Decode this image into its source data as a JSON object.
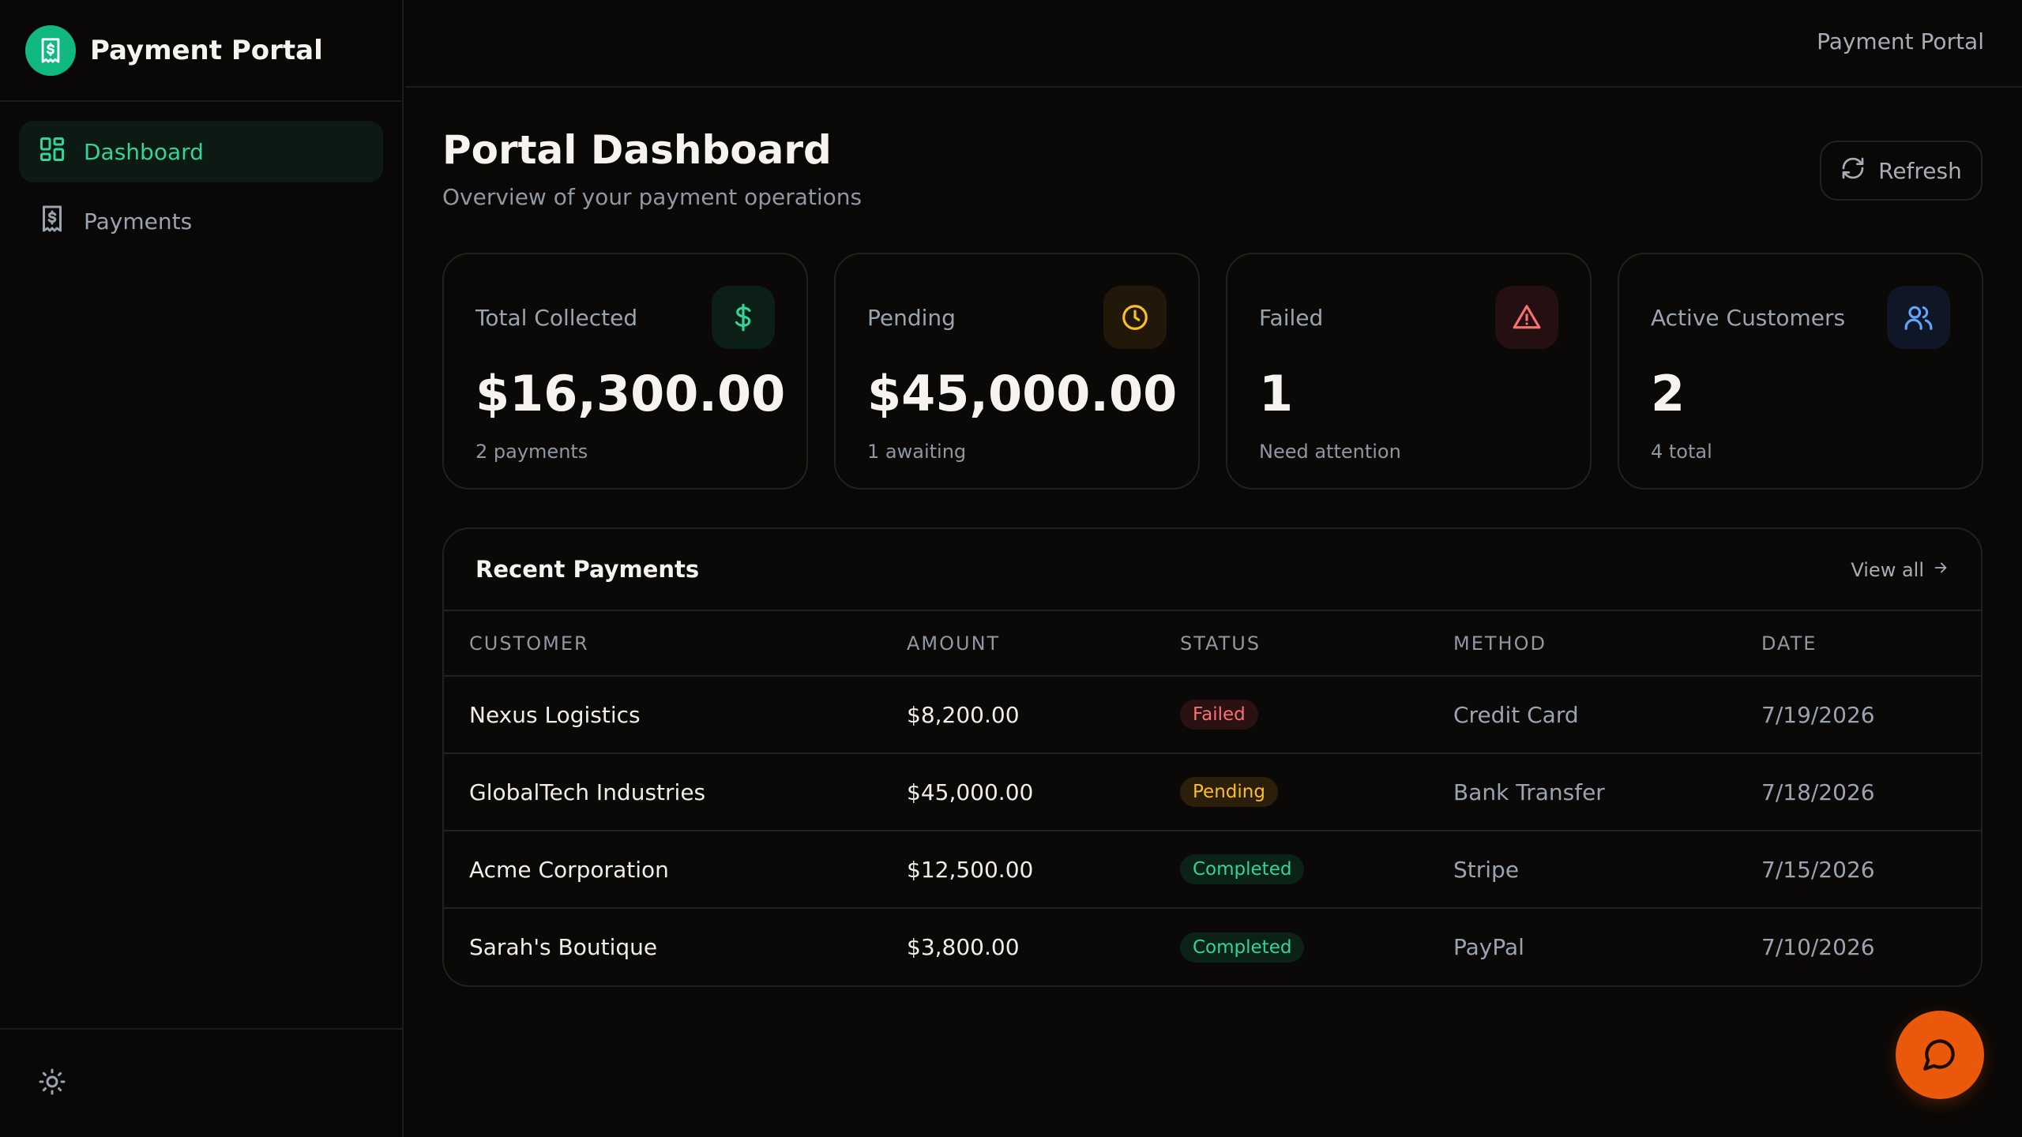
{
  "app": {
    "title": "Payment Portal"
  },
  "sidebar": {
    "items": [
      {
        "label": "Dashboard",
        "icon": "dashboard-grid-icon",
        "active": true
      },
      {
        "label": "Payments",
        "icon": "receipt-dollar-icon",
        "active": false
      }
    ],
    "footer_icon": "sun-icon"
  },
  "topbar": {
    "title": "Payment Portal"
  },
  "header": {
    "title": "Portal Dashboard",
    "subtitle": "Overview of your payment operations",
    "refresh_label": "Refresh"
  },
  "stats": [
    {
      "label": "Total Collected",
      "value": "$16,300.00",
      "sub": "2 payments",
      "icon": "dollar-icon",
      "color": "#34d399"
    },
    {
      "label": "Pending",
      "value": "$45,000.00",
      "sub": "1 awaiting",
      "icon": "clock-icon",
      "color": "#fbbf24"
    },
    {
      "label": "Failed",
      "value": "1",
      "sub": "Need attention",
      "icon": "alert-triangle-icon",
      "color": "#f87171"
    },
    {
      "label": "Active Customers",
      "value": "2",
      "sub": "4 total",
      "icon": "users-icon",
      "color": "#60a5fa"
    }
  ],
  "recent_payments": {
    "title": "Recent Payments",
    "view_all_label": "View all",
    "columns": [
      "CUSTOMER",
      "AMOUNT",
      "STATUS",
      "METHOD",
      "DATE"
    ],
    "rows": [
      {
        "customer": "Nexus Logistics",
        "amount": "$8,200.00",
        "status": "Failed",
        "method": "Credit Card",
        "date": "7/19/2026"
      },
      {
        "customer": "GlobalTech Industries",
        "amount": "$45,000.00",
        "status": "Pending",
        "method": "Bank Transfer",
        "date": "7/18/2026"
      },
      {
        "customer": "Acme Corporation",
        "amount": "$12,500.00",
        "status": "Completed",
        "method": "Stripe",
        "date": "7/15/2026"
      },
      {
        "customer": "Sarah's Boutique",
        "amount": "$3,800.00",
        "status": "Completed",
        "method": "PayPal",
        "date": "7/10/2026"
      }
    ]
  },
  "colors": {
    "accent": "#10b981",
    "chat_button": "#ea580c"
  }
}
